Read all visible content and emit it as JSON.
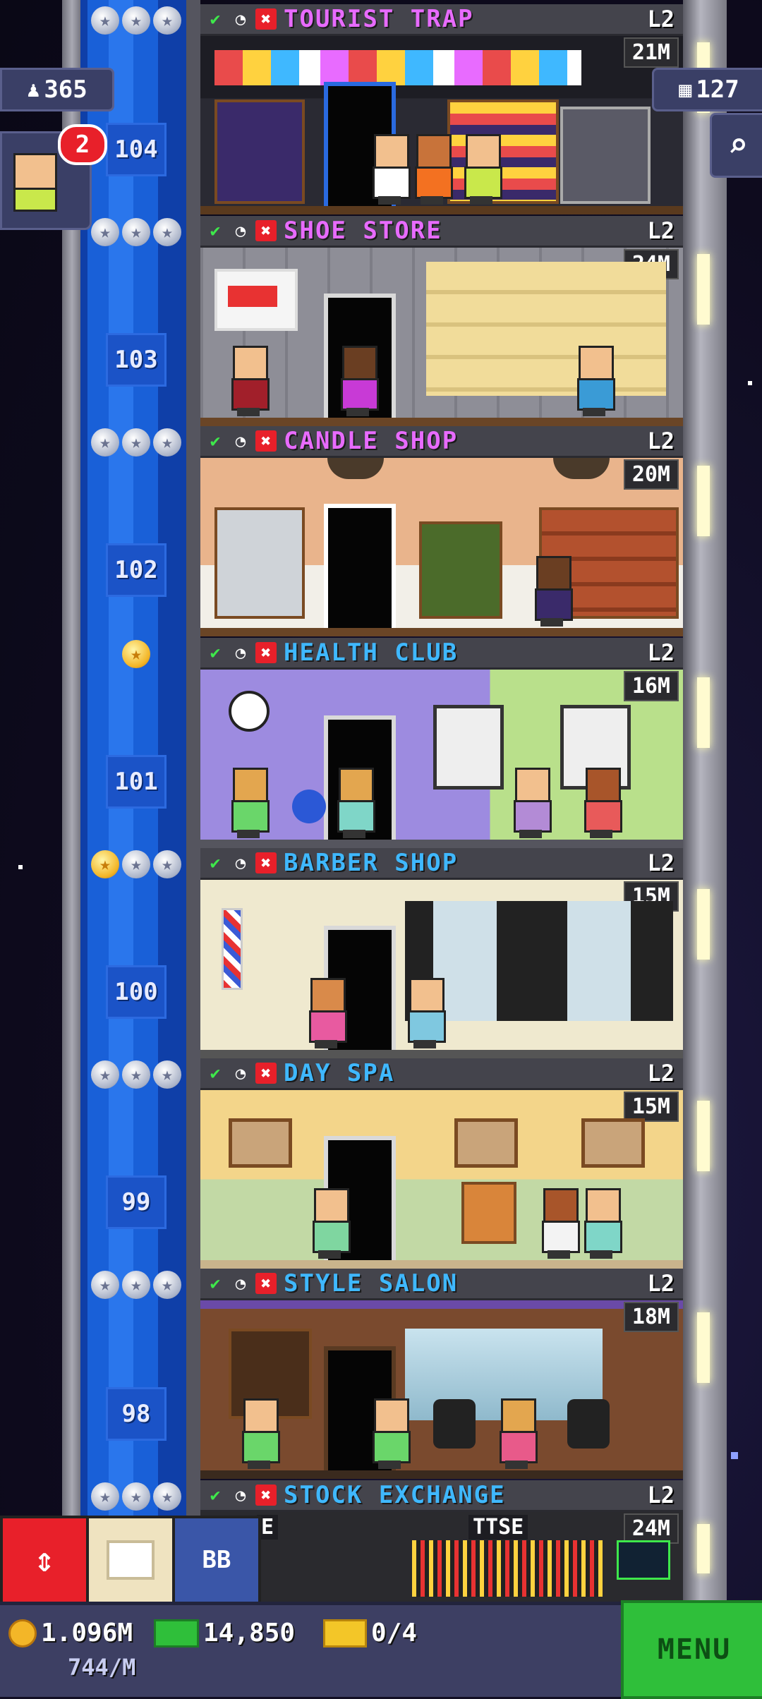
{
  "hud": {
    "population": "365",
    "floors_count": "127",
    "notification_badge": "2",
    "coins": "1.096M",
    "coin_rate": "744/M",
    "bux": "14,850",
    "tickets": "0/4",
    "menu_label": "MENU",
    "tool_bb_label": "BB"
  },
  "floors": [
    {
      "number": "104",
      "name": "TOURIST TRAP",
      "level": "L2",
      "price": "21M",
      "name_color": "#e86bff"
    },
    {
      "number": "103",
      "name": "SHOE STORE",
      "level": "L2",
      "price": "24M",
      "name_color": "#e86bff"
    },
    {
      "number": "102",
      "name": "CANDLE SHOP",
      "level": "L2",
      "price": "20M",
      "name_color": "#e86bff"
    },
    {
      "number": "101",
      "name": "HEALTH CLUB",
      "level": "L2",
      "price": "16M",
      "name_color": "#3fb8ff"
    },
    {
      "number": "100",
      "name": "BARBER SHOP",
      "level": "L2",
      "price": "15M",
      "name_color": "#3fb8ff"
    },
    {
      "number": "99",
      "name": "DAY SPA",
      "level": "L2",
      "price": "15M",
      "name_color": "#3fb8ff"
    },
    {
      "number": "98",
      "name": "STYLE SALON",
      "level": "L2",
      "price": "18M",
      "name_color": "#3fb8ff"
    },
    {
      "number": "",
      "name": "STOCK EXCHANGE",
      "level": "L2",
      "price": "24M",
      "name_color": "#3fb8ff"
    }
  ],
  "stock_signs": {
    "left": "E",
    "right": "TTSE"
  },
  "colors": {
    "shaft_blue": "#1960d8",
    "check_green": "#3ee84b",
    "cancel_red": "#e8202a",
    "menu_green": "#2fbf3a"
  }
}
